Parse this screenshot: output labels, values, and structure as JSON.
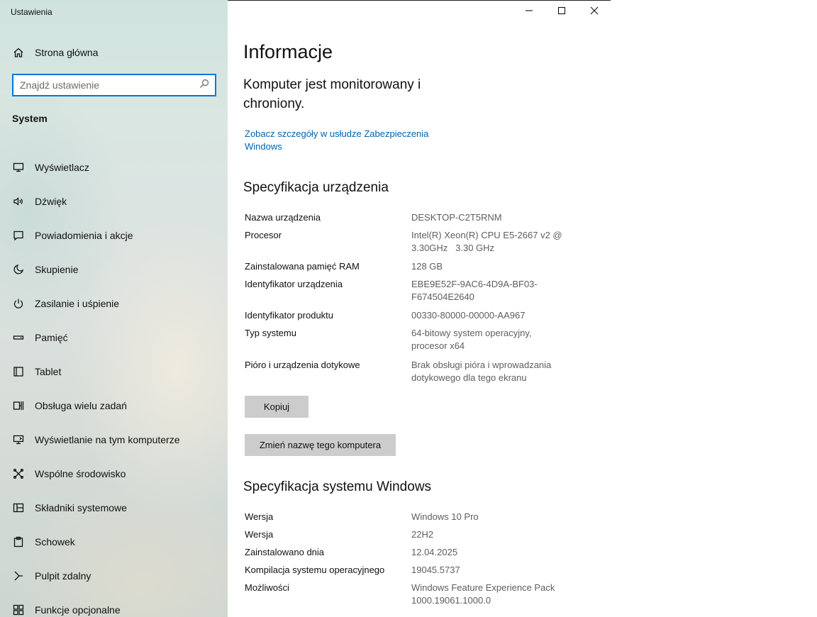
{
  "window": {
    "title": "Ustawienia",
    "controls": {
      "minimize": "minimize-icon",
      "maximize": "maximize-icon",
      "close": "close-icon"
    }
  },
  "sidebar": {
    "home_label": "Strona główna",
    "search": {
      "placeholder": "Znajdź ustawienie",
      "value": ""
    },
    "section_title": "System",
    "items": [
      {
        "label": "Wyświetlacz",
        "icon": "monitor-icon"
      },
      {
        "label": "Dźwięk",
        "icon": "speaker-icon"
      },
      {
        "label": "Powiadomienia i akcje",
        "icon": "notification-icon"
      },
      {
        "label": "Skupienie",
        "icon": "moon-icon"
      },
      {
        "label": "Zasilanie i uśpienie",
        "icon": "power-icon"
      },
      {
        "label": "Pamięć",
        "icon": "storage-icon"
      },
      {
        "label": "Tablet",
        "icon": "tablet-icon"
      },
      {
        "label": "Obsługa wielu zadań",
        "icon": "multitasking-icon"
      },
      {
        "label": "Wyświetlanie na tym komputerze",
        "icon": "projecting-icon"
      },
      {
        "label": "Wspólne środowisko",
        "icon": "shared-experiences-icon"
      },
      {
        "label": "Składniki systemowe",
        "icon": "system-components-icon"
      },
      {
        "label": "Schowek",
        "icon": "clipboard-icon"
      },
      {
        "label": "Pulpit zdalny",
        "icon": "remote-desktop-icon"
      },
      {
        "label": "Funkcje opcjonalne",
        "icon": "optional-features-icon"
      }
    ]
  },
  "main": {
    "page_title": "Informacje",
    "status_text": "Komputer jest monitorowany i chroniony.",
    "security_link": "Zobacz szczegóły w usłudze Zabezpieczenia Windows",
    "device_specs_heading": "Specyfikacja urządzenia",
    "device_specs": [
      {
        "key": "Nazwa urządzenia",
        "value": "DESKTOP-C2T5RNM"
      },
      {
        "key": "Procesor",
        "value": "Intel(R) Xeon(R) CPU E5-2667 v2 @ 3.30GHz   3.30 GHz"
      },
      {
        "key": "Zainstalowana pamięć RAM",
        "value": "128 GB"
      },
      {
        "key": "Identyfikator urządzenia",
        "value": "EBE9E52F-9AC6-4D9A-BF03-F674504E2640"
      },
      {
        "key": "Identyfikator produktu",
        "value": "00330-80000-00000-AA967"
      },
      {
        "key": "Typ systemu",
        "value": "64-bitowy system operacyjny, procesor x64"
      },
      {
        "key": "Pióro i urządzenia dotykowe",
        "value": "Brak obsługi pióra i wprowadzania dotykowego dla tego ekranu"
      }
    ],
    "copy_button": "Kopiuj",
    "rename_button": "Zmień nazwę tego komputera",
    "windows_specs_heading": "Specyfikacja systemu Windows",
    "windows_specs": [
      {
        "key": "Wersja",
        "value": "Windows 10 Pro"
      },
      {
        "key": "Wersja",
        "value": "22H2"
      },
      {
        "key": "Zainstalowano dnia",
        "value": "12.04.2025"
      },
      {
        "key": "Kompilacja systemu operacyjnego",
        "value": "19045.5737"
      },
      {
        "key": "Możliwości",
        "value": "Windows Feature Experience Pack 1000.19061.1000.0"
      }
    ]
  }
}
